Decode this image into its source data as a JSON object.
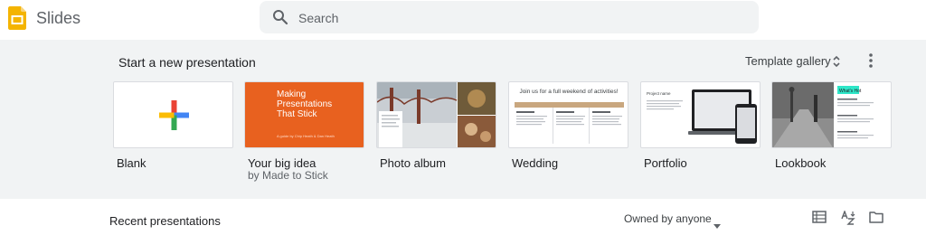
{
  "header": {
    "app_name": "Slides",
    "search_placeholder": "Search"
  },
  "start": {
    "title": "Start a new presentation",
    "template_gallery_label": "Template gallery",
    "templates": [
      {
        "label": "Blank"
      },
      {
        "label": "Your big idea",
        "sublabel": "by Made to Stick",
        "thumb_title": "Making Presentations That Stick",
        "thumb_sub": "A guide by Chip Heath & Dan Heath"
      },
      {
        "label": "Photo album"
      },
      {
        "label": "Wedding",
        "thumb_title": "Join us for a full weekend of activities!"
      },
      {
        "label": "Portfolio",
        "thumb_title": "Project name"
      },
      {
        "label": "Lookbook",
        "thumb_title": "What's Hot"
      }
    ]
  },
  "recent": {
    "title": "Recent presentations",
    "owner_filter": "Owned by anyone"
  },
  "colors": {
    "slides_yellow": "#f4b400",
    "idea_orange": "#e8611f",
    "wedding_tan": "#c9a77f",
    "lookbook_teal": "#2ee6c8"
  }
}
